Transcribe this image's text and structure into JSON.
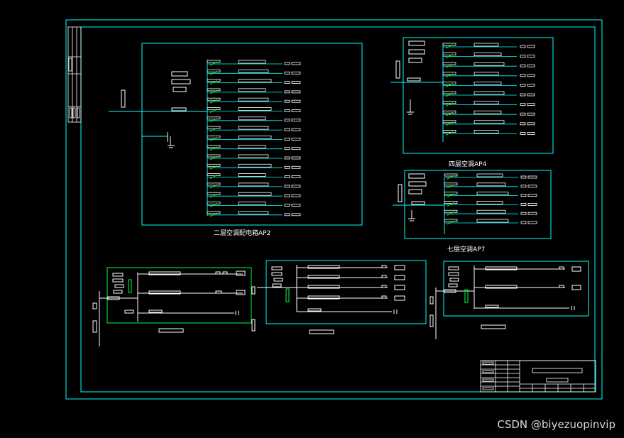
{
  "colors": {
    "background": "#000000",
    "frame": "#00ffff",
    "wire": "#00ffff",
    "panel_alt": "#00ff44",
    "breaker": "#00ff00",
    "box": "#ffffff"
  },
  "captions": {
    "panel_ap2": "二层空调配电箱AP2",
    "panel_ap4": "四层空调AP4",
    "panel_ap7": "七层空调AP7"
  },
  "watermark": "CSDN @biyezuopinvip",
  "panels": {
    "ap2_circuits": 17,
    "ap4_circuits": 10,
    "ap7_circuits": 6
  }
}
